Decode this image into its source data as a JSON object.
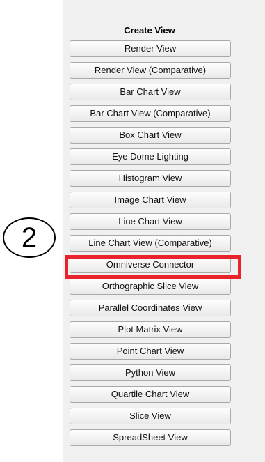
{
  "panel": {
    "title": "Create View",
    "buttons": [
      {
        "label": "Render View"
      },
      {
        "label": "Render View (Comparative)"
      },
      {
        "label": "Bar Chart View"
      },
      {
        "label": "Bar Chart View (Comparative)"
      },
      {
        "label": "Box Chart View"
      },
      {
        "label": "Eye Dome Lighting"
      },
      {
        "label": "Histogram View"
      },
      {
        "label": "Image Chart View"
      },
      {
        "label": "Line Chart View"
      },
      {
        "label": "Line Chart View (Comparative)"
      },
      {
        "label": "Omniverse Connector"
      },
      {
        "label": "Orthographic Slice View"
      },
      {
        "label": "Parallel Coordinates View"
      },
      {
        "label": "Plot Matrix View"
      },
      {
        "label": "Point Chart View"
      },
      {
        "label": "Python View"
      },
      {
        "label": "Quartile Chart View"
      },
      {
        "label": "Slice View"
      },
      {
        "label": "SpreadSheet View"
      }
    ]
  },
  "annotation": {
    "step_number": "2",
    "highlight_color": "#e8232b"
  }
}
